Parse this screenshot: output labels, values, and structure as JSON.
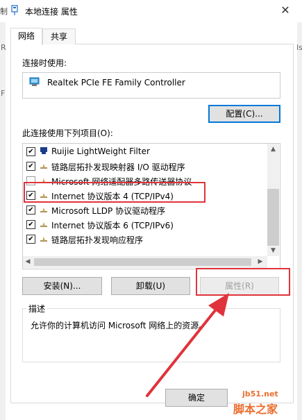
{
  "window": {
    "title": "本地连接 属性",
    "close_glyph": "✕",
    "left_edge_text": "制"
  },
  "tabs": [
    {
      "label": "网络",
      "active": true
    },
    {
      "label": "共享",
      "active": false
    }
  ],
  "edges": {
    "right_chars": "ls",
    "left_chars": "R",
    "left_chars2": "F"
  },
  "network": {
    "connect_using_label": "连接时使用:",
    "adapter_name": "Realtek PCIe FE Family Controller",
    "configure_label": "配置(C)...",
    "items_label": "此连接使用下列项目(O):",
    "items": [
      {
        "checked": true,
        "text": "Ruijie LightWeight Filter",
        "icon": "filter-icon"
      },
      {
        "checked": true,
        "text": "链路层拓扑发现映射器 I/O 驱动程序",
        "icon": "protocol-icon"
      },
      {
        "checked": false,
        "text": "Microsoft 网络适配器多路传送器协议",
        "icon": "protocol-icon"
      },
      {
        "checked": true,
        "text": "Internet 协议版本 4 (TCP/IPv4)",
        "icon": "protocol-icon"
      },
      {
        "checked": true,
        "text": "Microsoft LLDP 协议驱动程序",
        "icon": "protocol-icon"
      },
      {
        "checked": true,
        "text": "Internet 协议版本 6 (TCP/IPv6)",
        "icon": "protocol-icon"
      },
      {
        "checked": true,
        "text": "链路层拓扑发现响应程序",
        "icon": "protocol-icon"
      }
    ],
    "install_label": "安装(N)...",
    "uninstall_label": "卸载(U)",
    "properties_label": "属性(R)",
    "description_label": "描述",
    "description_text": "允许你的计算机访问 Microsoft 网络上的资源。",
    "ok_label": "确定"
  },
  "colors": {
    "highlight_red": "#e0333b",
    "focus_blue": "#0078d7",
    "watermark_orange": "#ea6d2f"
  },
  "watermark": {
    "domain": "jb51.net",
    "site_name": "脚本之家"
  }
}
